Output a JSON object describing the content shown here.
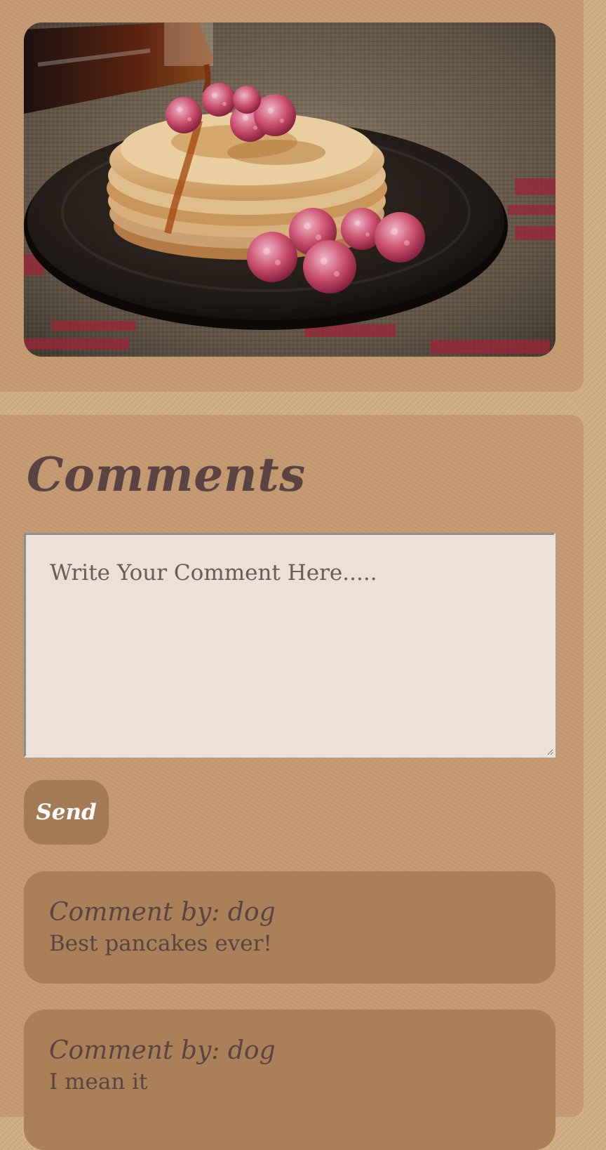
{
  "photo": {
    "alt_icon": "pancake-photo-image"
  },
  "comments_section": {
    "title": "Comments",
    "input": {
      "placeholder": "Write Your Comment Here.....",
      "value": ""
    },
    "send_label": "Send",
    "items": [
      {
        "author": "Comment by: dog",
        "text": "Best pancakes ever!"
      },
      {
        "author": "Comment by: dog",
        "text": "I mean it"
      }
    ]
  },
  "colors": {
    "page_background": "#d2ad87",
    "card_background": "#c59a71",
    "comment_card": "#a98058",
    "button": "#a47b57",
    "text_dark": "#5a4340"
  }
}
